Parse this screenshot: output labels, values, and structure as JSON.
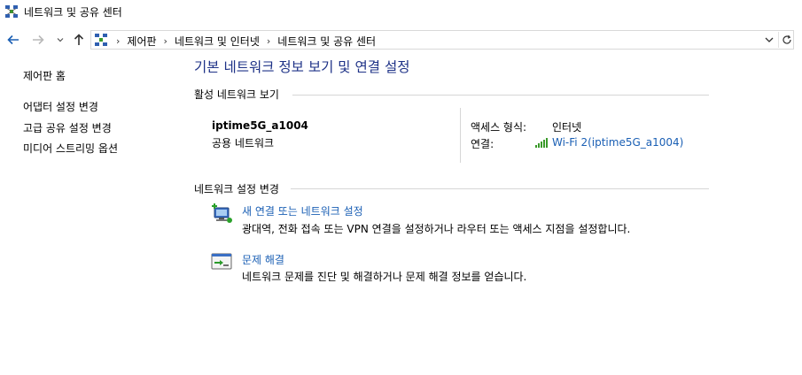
{
  "window": {
    "title": "네트워크 및 공유 센터",
    "icon": "network-center-icon"
  },
  "nav": {
    "back_icon": "back-arrow-icon",
    "forward_icon": "forward-arrow-icon",
    "recent_icon": "chevron-down-icon",
    "up_icon": "up-arrow-icon",
    "breadcrumbs": [
      "제어판",
      "네트워크 및 인터넷",
      "네트워크 및 공유 센터"
    ],
    "separator": "›",
    "dropdown_icon": "chevron-down-icon",
    "refresh_icon": "refresh-icon"
  },
  "sidebar": {
    "home": "제어판 홈",
    "items": [
      {
        "label": "어댑터 설정 변경"
      },
      {
        "label": "고급 공유 설정 변경"
      },
      {
        "label": "미디어 스트리밍 옵션"
      }
    ]
  },
  "main": {
    "title": "기본 네트워크 정보 보기 및 연결 설정",
    "active_section": "활성 네트워크 보기",
    "network": {
      "name": "iptime5G_a1004",
      "type": "공용 네트워크",
      "access_label": "액세스 형식:",
      "access_value": "인터넷",
      "connection_label": "연결:",
      "connection_value": "Wi-Fi 2(iptime5G_a1004)",
      "connection_icon": "wifi-signal-icon"
    },
    "change_section": "네트워크 설정 변경",
    "tasks": [
      {
        "link": "새 연결 또는 네트워크 설정",
        "desc": "광대역, 전화 접속 또는 VPN 연결을 설정하거나 라우터 또는 액세스 지점을 설정합니다.",
        "icon": "new-connection-icon"
      },
      {
        "link": "문제 해결",
        "desc": "네트워크 문제를 진단 및 해결하거나 문제 해결 정보를 얻습니다.",
        "icon": "troubleshoot-icon"
      }
    ]
  },
  "colors": {
    "title_blue": "#1e3287",
    "link_blue": "#1a5fb4",
    "divider": "#d6d6d6",
    "signal_green": "#3a9a2a"
  }
}
